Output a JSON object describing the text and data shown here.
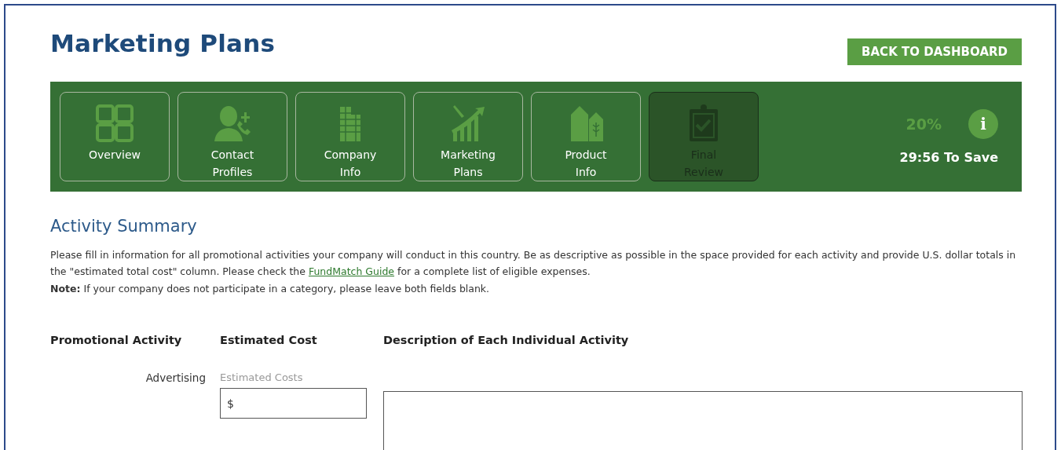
{
  "header": {
    "title": "Marketing Plans",
    "back_button": "BACK TO DASHBOARD"
  },
  "steps": [
    {
      "kind": "grid",
      "label": "Overview",
      "disabled": false
    },
    {
      "kind": "contact",
      "label": "Contact Profiles",
      "disabled": false
    },
    {
      "kind": "building",
      "label": "Company Info",
      "disabled": false
    },
    {
      "kind": "chart",
      "label": "Marketing Plans",
      "disabled": false
    },
    {
      "kind": "product",
      "label": "Product Info",
      "disabled": false
    },
    {
      "kind": "clipboard",
      "label": "Final Review",
      "disabled": true
    }
  ],
  "progress": {
    "percent": "20%",
    "info": "i",
    "timer": "29:56 To Save"
  },
  "section": {
    "title": "Activity Summary",
    "intro_before": "Please fill in information for all promotional activities your company will conduct in this country. Be as descriptive as possible in the space provided for each activity and provide U.S. dollar totals in the \"estimated total cost\" column. Please check the",
    "link": "FundMatch Guide",
    "intro_after": "for a complete list of eligible expenses.",
    "note": "**Note:** If your company does not participate in a category, please leave both fields blank."
  },
  "table": {
    "columns": [
      "Promotional Activity",
      "Estimated Cost",
      "Description of Each Individual Activity"
    ],
    "rows": [
      {
        "activity": "Advertising",
        "cost_label": "Estimated Costs",
        "cost_value": "$"
      }
    ]
  }
}
